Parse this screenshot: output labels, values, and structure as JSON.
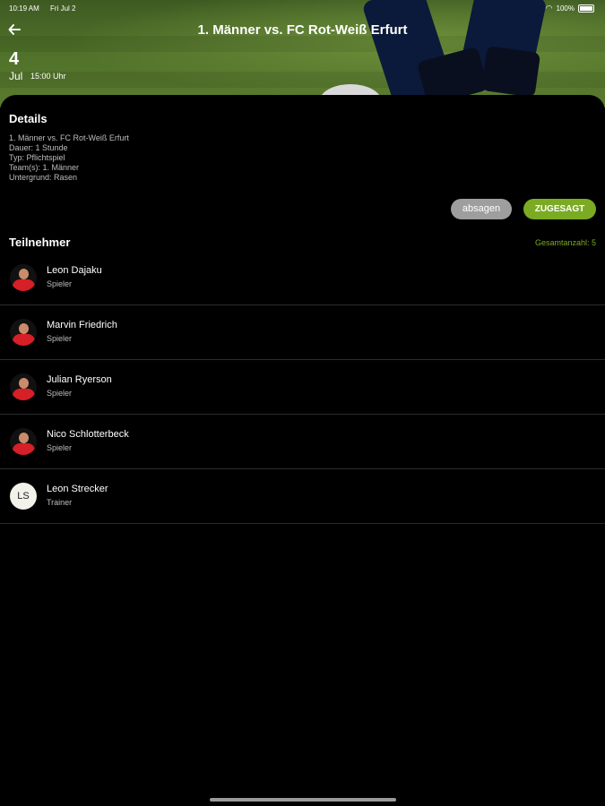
{
  "status_bar": {
    "time": "10:19 AM",
    "date": "Fri Jul 2",
    "battery": "100%"
  },
  "header": {
    "title": "1. Männer vs. FC Rot-Weiß Erfurt",
    "day": "4",
    "month": "Jul",
    "time": "15:00 Uhr"
  },
  "details": {
    "heading": "Details",
    "lines": [
      "1. Männer vs. FC Rot-Weiß Erfurt",
      "Dauer: 1 Stunde",
      "Typ: Pflichtspiel",
      "Team(s): 1. Männer",
      "Untergrund: Rasen"
    ]
  },
  "actions": {
    "decline_label": "absagen",
    "accept_label": "ZUGESAGT"
  },
  "participants": {
    "heading": "Teilnehmer",
    "total": "Gesamtanzahl: 5",
    "items": [
      {
        "name": "Leon Dajaku",
        "role": "Spieler"
      },
      {
        "name": "Marvin Friedrich",
        "role": "Spieler"
      },
      {
        "name": "Julian Ryerson",
        "role": "Spieler"
      },
      {
        "name": "Nico Schlotterbeck",
        "role": "Spieler"
      },
      {
        "name": "Leon Strecker",
        "role": "Trainer",
        "initials": "LS"
      }
    ]
  },
  "colors": {
    "accent": "#7bab22",
    "decline": "#9e9e9e",
    "background": "#000000"
  },
  "icons": {
    "back": "arrow-left-icon",
    "wifi": "wifi-icon",
    "battery": "battery-icon"
  }
}
